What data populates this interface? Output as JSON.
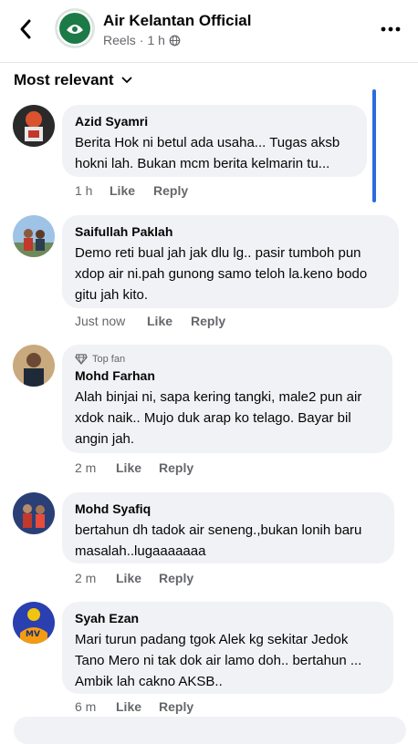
{
  "header": {
    "title": "Air Kelantan Official",
    "subtitle": "Reels",
    "time": "1 h",
    "dot": "·"
  },
  "sort": {
    "label": "Most relevant"
  },
  "comments": [
    {
      "name": "Azid Syamri",
      "text": "Berita Hok ni betul ada usaha... Tugas aksb hokni lah. Bukan mcm berita kelmarin tu...",
      "time": "1 h",
      "like": "Like",
      "reply": "Reply"
    },
    {
      "name": "Saifullah Paklah",
      "text": "Demo reti bual jah jak dlu lg.. pasir tumboh pun xdop air ni.pah gunong samo teloh la.keno bodo gitu jah kito.",
      "time": "Just now",
      "like": "Like",
      "reply": "Reply"
    },
    {
      "badge": "Top fan",
      "name": "Mohd Farhan",
      "text": "Alah binjai ni, sapa kering tangki, male2 pun air xdok naik.. Mujo duk arap ko telago. Bayar bil angin jah.",
      "time": "2 m",
      "like": "Like",
      "reply": "Reply"
    },
    {
      "name": "Mohd Syafiq",
      "text": "bertahun dh tadok air seneng.,bukan lonih baru masalah..lugaaaaaaa",
      "time": "2 m",
      "like": "Like",
      "reply": "Reply"
    },
    {
      "name": "Syah Ezan",
      "text": "Mari turun padang tgok Alek kg sekitar Jedok Tano Mero ni tak dok air lamo doh.. bertahun ... Ambik lah cakno AKSB..",
      "time": "6 m",
      "like": "Like",
      "reply": "Reply"
    }
  ],
  "colors": {
    "accent": "#2d6cdf",
    "bubble": "#f0f2f5",
    "muted": "#65676b"
  }
}
